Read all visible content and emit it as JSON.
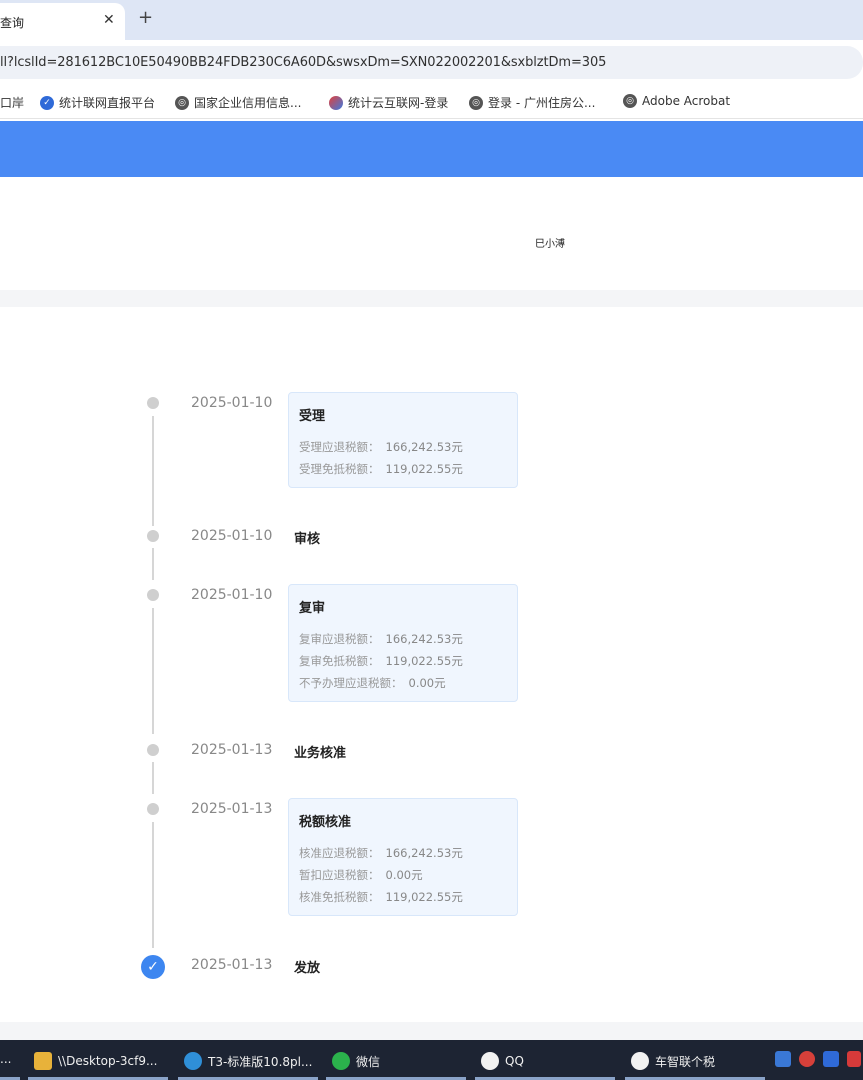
{
  "browser": {
    "tab_title": "查询",
    "tab_close": "✕",
    "tab_new": "+",
    "url": "ll?lcslId=281612BC10E50490BB24FDB230C6A60D&swsxDm=SXN022002201&sxblztDm=305",
    "bookmarks": [
      {
        "label": "口岸",
        "icon": "none"
      },
      {
        "label": "统计联网直报平台",
        "icon": "stats-icon"
      },
      {
        "label": "国家企业信用信息...",
        "icon": "globe-icon"
      },
      {
        "label": "统计云互联网-登录",
        "icon": "swirl-icon"
      },
      {
        "label": "登录 - 广州住房公...",
        "icon": "globe-icon"
      },
      {
        "label": "Adobe Acrobat",
        "icon": "globe-icon"
      }
    ]
  },
  "header": {
    "small_text": "巳小溥"
  },
  "timeline": [
    {
      "date": "2025-01-10",
      "title": "受理",
      "lines": [
        {
          "label": "受理应退税额：",
          "value": "166,242.53元"
        },
        {
          "label": "受理免抵税额：",
          "value": "119,022.55元"
        }
      ]
    },
    {
      "date": "2025-01-10",
      "title": "审核",
      "lines": []
    },
    {
      "date": "2025-01-10",
      "title": "复审",
      "lines": [
        {
          "label": "复审应退税额：",
          "value": "166,242.53元"
        },
        {
          "label": "复审免抵税额：",
          "value": "119,022.55元"
        },
        {
          "label": "不予办理应退税额：",
          "value": "0.00元"
        }
      ]
    },
    {
      "date": "2025-01-13",
      "title": "业务核准",
      "lines": []
    },
    {
      "date": "2025-01-13",
      "title": "税额核准",
      "lines": [
        {
          "label": "核准应退税额：",
          "value": "166,242.53元"
        },
        {
          "label": "暂扣应退税额：",
          "value": "0.00元"
        },
        {
          "label": "核准免抵税额：",
          "value": "119,022.55元"
        }
      ]
    },
    {
      "date": "2025-01-13",
      "title": "发放",
      "lines": [],
      "done": true
    }
  ],
  "taskbar": {
    "items": [
      {
        "label": "..."
      },
      {
        "label": "\\\\Desktop-3cf9..."
      },
      {
        "label": "T3-标准版10.8pl..."
      },
      {
        "label": "微信"
      },
      {
        "label": "QQ"
      },
      {
        "label": "车智联个税"
      }
    ]
  },
  "colors": {
    "accent": "#4a8af4",
    "card_bg": "#f0f6fe",
    "done": "#3d86f0"
  }
}
